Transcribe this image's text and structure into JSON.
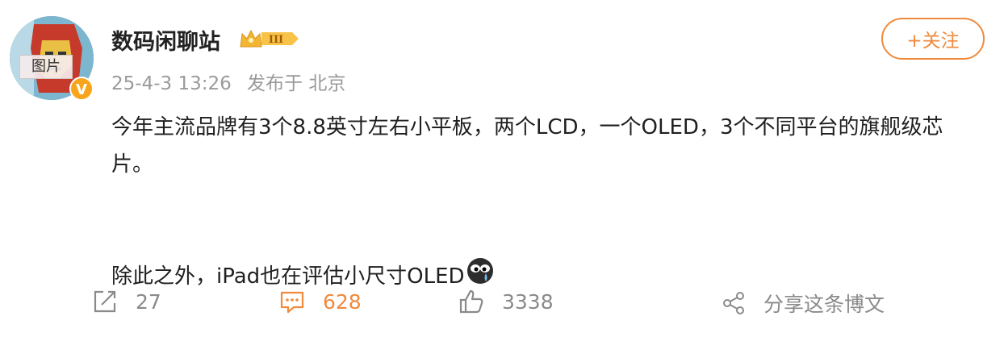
{
  "user": {
    "name": "数码闲聊站",
    "rank": "III",
    "avatar_tag": "图片",
    "verified_mark": "V"
  },
  "meta": {
    "time": "25-4-3 13:26",
    "location": "发布于 北京"
  },
  "follow_label": "+关注",
  "content": {
    "line1": "今年主流品牌有3个8.8英寸左右小平板，两个LCD，一个OLED，3个不同平台的旗舰级芯片。",
    "line2": "除此之外，iPad也在评估小尺寸OLED"
  },
  "actions": {
    "repost_count": "27",
    "comment_count": "628",
    "like_count": "3338",
    "share_label": "分享这条博文"
  },
  "colors": {
    "accent": "#f08a3c",
    "muted": "#9a9a9a",
    "badge": "#f8a51c"
  }
}
